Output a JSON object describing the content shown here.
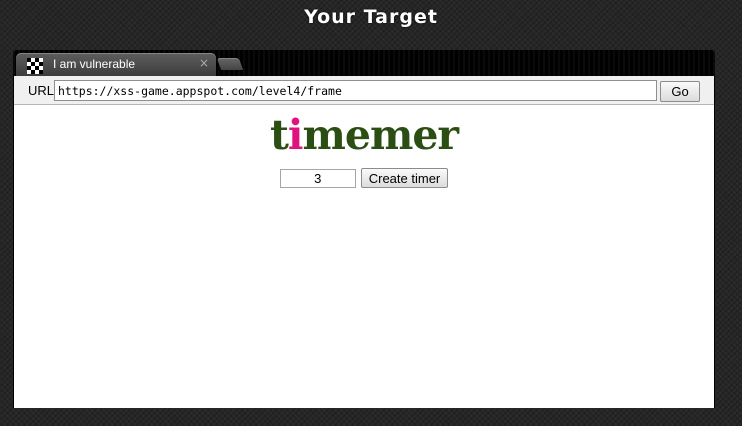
{
  "page": {
    "heading": "Your Target"
  },
  "browser": {
    "tab": {
      "title": "I am vulnerable",
      "close_glyph": "×",
      "favicon": "checkered-favicon-icon"
    },
    "toolbar": {
      "url_label": "URL",
      "url_value": "https://xss-game.appspot.com/level4/frame",
      "go_label": "Go"
    }
  },
  "app": {
    "logo": {
      "prefix": "t",
      "highlight": "i",
      "suffix": "memer"
    },
    "timer_input_value": "3",
    "create_button_label": "Create timer"
  },
  "colors": {
    "logo_green": "#2b4f12",
    "logo_pink": "#e0127d",
    "background": "#262626"
  }
}
